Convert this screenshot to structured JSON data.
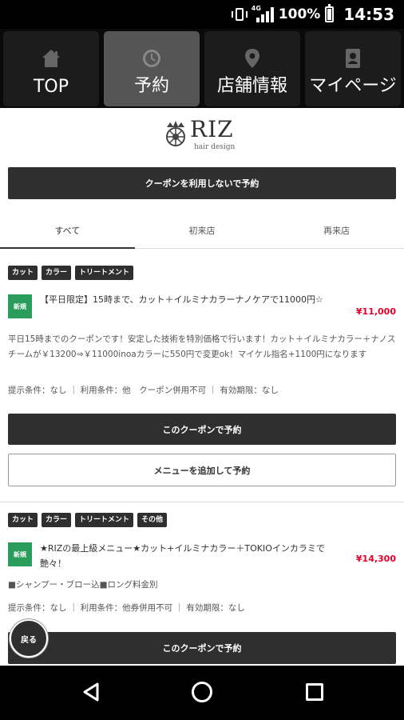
{
  "status": {
    "battery": "100%",
    "time": "14:53",
    "network": "4G"
  },
  "nav": [
    {
      "label": "TOP",
      "icon": "home-icon"
    },
    {
      "label": "予約",
      "icon": "clock-icon"
    },
    {
      "label": "店舗情報",
      "icon": "map-pin-icon"
    },
    {
      "label": "マイページ",
      "icon": "id-card-icon"
    }
  ],
  "logo": {
    "name": "RIZ",
    "sub": "hair design"
  },
  "no_coupon_button": "クーポンを利用しないで予約",
  "tabs": [
    "すべて",
    "初来店",
    "再来店"
  ],
  "coupons": [
    {
      "tags": [
        "カット",
        "カラー",
        "トリートメント"
      ],
      "badge": "新規",
      "title": "【平日限定】15時まで、カット＋イルミナカラーナノケアで11000円☆",
      "price": "¥11,000",
      "description": "平日15時までのクーポンです！安定した技術を特別価格で行います！カット＋イルミナカラー＋ナノスチームが￥13200⇒￥11000inoaカラーに550円で変更ok！マイケル指名+1100円になります",
      "conditions": "提示条件：なし ｜ 利用条件：他　クーポン併用不可 ｜ 有効期限：なし",
      "reserve_button": "このクーポンで予約",
      "add_menu_button": "メニューを追加して予約"
    },
    {
      "tags": [
        "カット",
        "カラー",
        "トリートメント",
        "その他"
      ],
      "badge": "新規",
      "title": "★RIZの最上級メニュー★カット+イルミナカラー＋TOKIOインカラミで艶々！",
      "price": "¥14,300",
      "description": "■シャンプー・ブロー込■ロング料金別",
      "conditions": "提示条件：なし ｜ 利用条件：他券併用不可 ｜ 有効期限：なし",
      "reserve_button": "このクーポンで予約"
    }
  ],
  "back_button": "戻る"
}
